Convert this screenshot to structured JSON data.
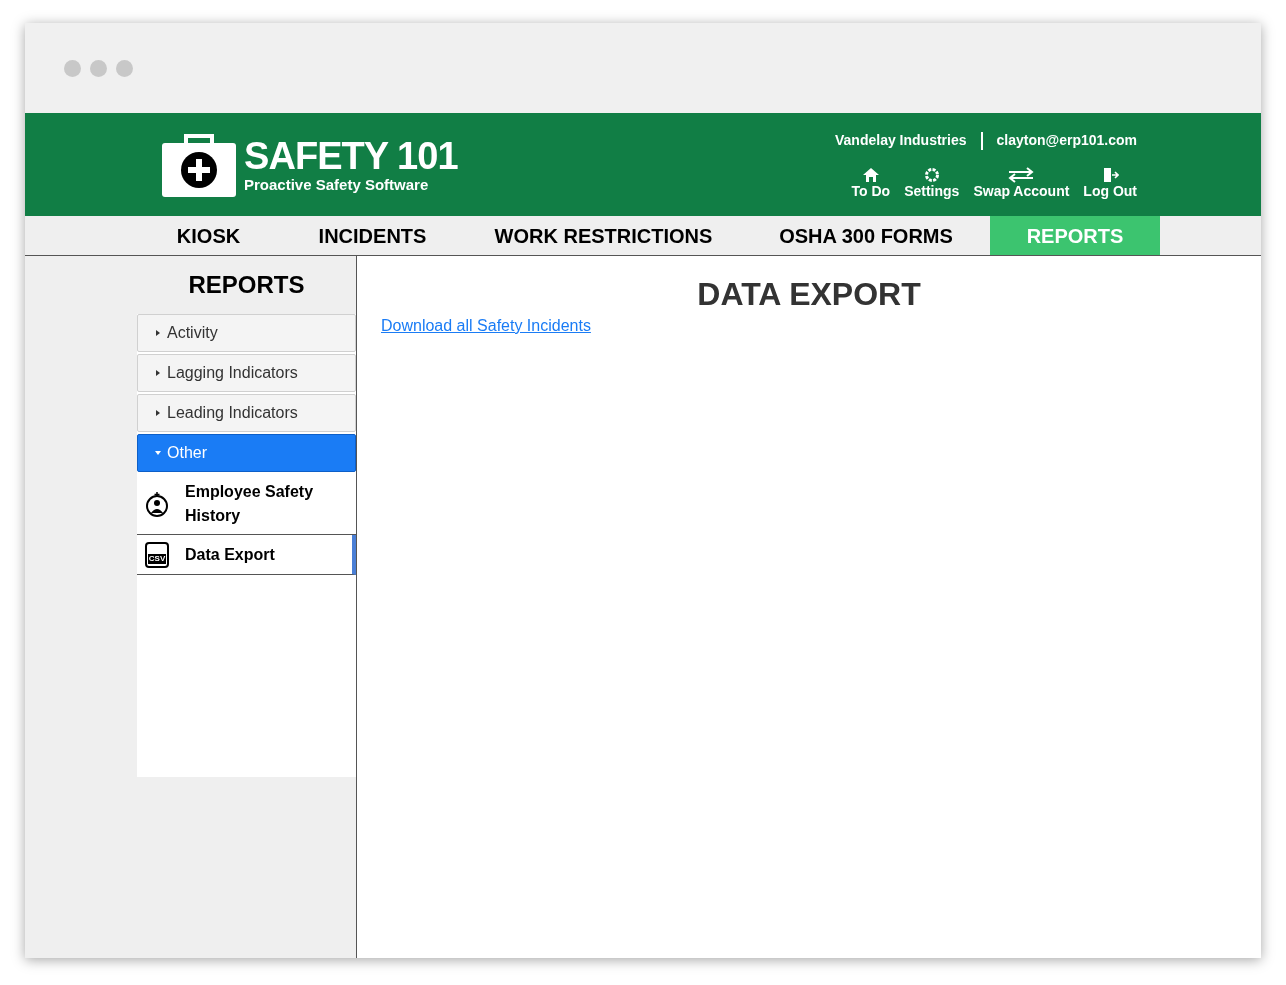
{
  "header": {
    "logo_title": "SAFETY 101",
    "logo_subtitle": "Proactive Safety Software",
    "company": "Vandelay Industries",
    "email": "clayton@erp101.com",
    "actions": [
      {
        "kind": "home",
        "label": "To Do"
      },
      {
        "kind": "gear",
        "label": "Settings"
      },
      {
        "kind": "swap",
        "label": "Swap Account"
      },
      {
        "kind": "logout",
        "label": "Log Out"
      }
    ]
  },
  "tabs": [
    {
      "label": "KIOSK",
      "selected": false
    },
    {
      "label": "INCIDENTS",
      "selected": false
    },
    {
      "label": "WORK RESTRICTIONS",
      "selected": false
    },
    {
      "label": "OSHA 300 FORMS",
      "selected": false
    },
    {
      "label": "REPORTS",
      "selected": true
    }
  ],
  "sidebar": {
    "title": "REPORTS",
    "groups": [
      {
        "label": "Activity",
        "expanded": false
      },
      {
        "label": "Lagging Indicators",
        "expanded": false
      },
      {
        "label": "Leading Indicators",
        "expanded": false
      },
      {
        "label": "Other",
        "expanded": true,
        "children": [
          {
            "kind": "person",
            "label": "Employee Safety History",
            "selected": false
          },
          {
            "kind": "csv",
            "badge": "CSV",
            "label": "Data Export",
            "selected": true
          }
        ]
      }
    ]
  },
  "main": {
    "title": "DATA EXPORT",
    "link": "Download all Safety Incidents"
  }
}
